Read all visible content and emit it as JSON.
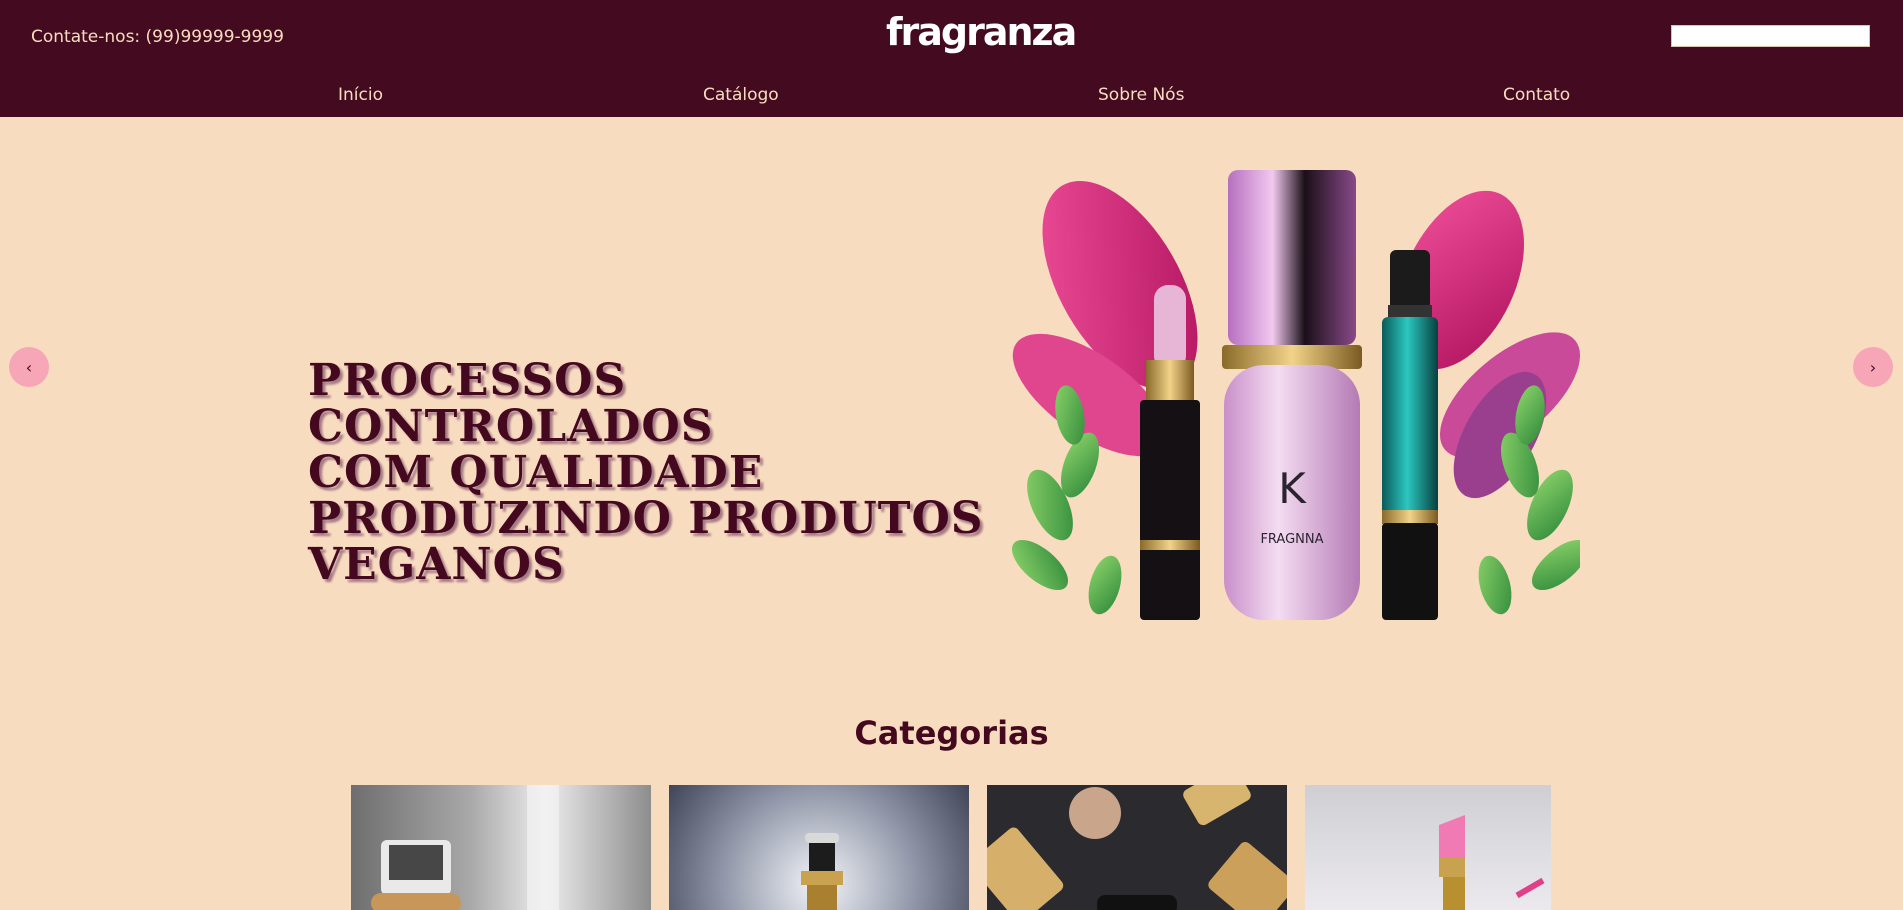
{
  "header": {
    "contact": "Contate-nos: (99)99999-9999",
    "logo": "fragranza",
    "search_placeholder": ""
  },
  "nav": {
    "items": [
      {
        "label": "Início"
      },
      {
        "label": "Catálogo"
      },
      {
        "label": "Sobre Nós"
      },
      {
        "label": "Contato"
      }
    ]
  },
  "hero": {
    "lines": [
      "PROCESSOS CONTROLADOS",
      "COM QUALIDADE",
      "PRODUZINDO PRODUTOS",
      "VEGANOS"
    ],
    "bottle_letter": "K",
    "bottle_brand": "FRAGNNA",
    "prev_icon": "chevron-left-icon",
    "next_icon": "chevron-right-icon"
  },
  "categories": {
    "title": "Categorias",
    "items": [
      {
        "image": "serum-bottle-image"
      },
      {
        "image": "perfume-bottle-image"
      },
      {
        "image": "makeup-brush-image"
      },
      {
        "image": "lipstick-image"
      }
    ]
  },
  "colors": {
    "header_bg": "#440a1f",
    "page_bg": "#f8dcc0",
    "accent_pink": "#f7a6b7"
  }
}
